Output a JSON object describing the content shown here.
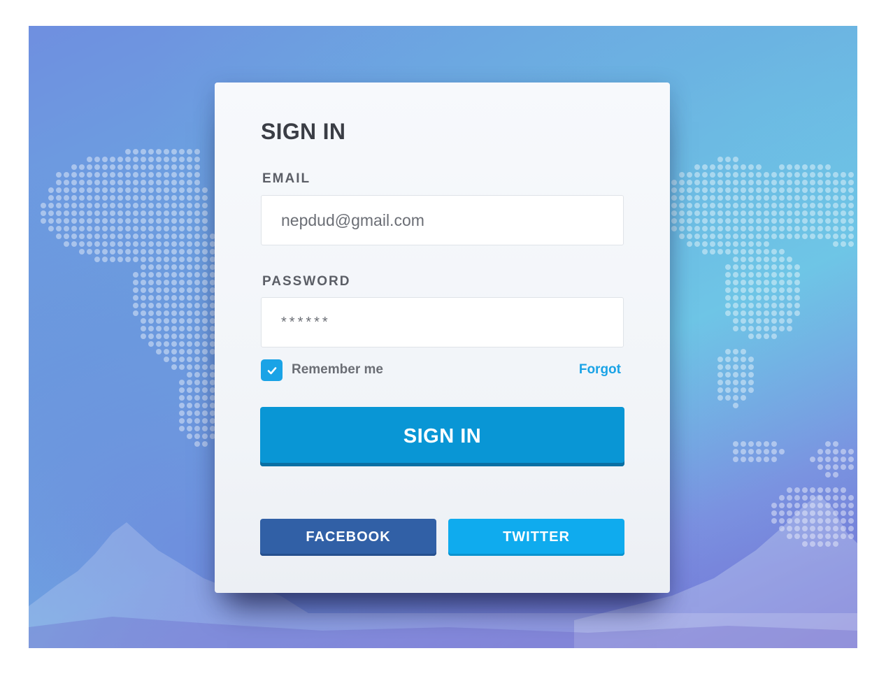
{
  "background": {
    "gradient_colors": [
      "#6f8fe0",
      "#6ec3e6",
      "#6f6fd2"
    ]
  },
  "login": {
    "title": "SIGN IN",
    "email_label": "EMAIL",
    "email_value": "nepdud@gmail.com",
    "password_label": "PASSWORD",
    "password_value": "******",
    "remember_label": "Remember me",
    "remember_checked": true,
    "forgot_label": "Forgot",
    "submit_label": "SIGN IN"
  },
  "social": {
    "facebook_label": "FACEBOOK",
    "twitter_label": "TWITTER"
  },
  "colors": {
    "primary": "#0996d5",
    "accent": "#1aa3e6",
    "facebook": "#3160a6",
    "twitter": "#0fabee",
    "text_dark": "#3a3d45"
  },
  "icons": {
    "checkbox": "check-icon"
  }
}
